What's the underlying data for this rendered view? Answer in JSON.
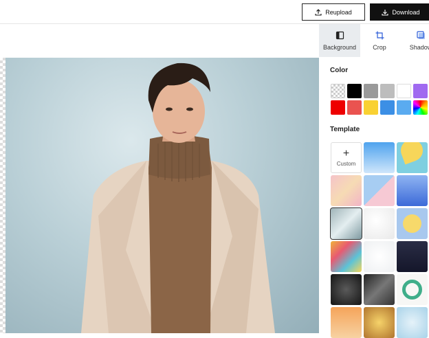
{
  "header": {
    "reupload_label": "Reupload",
    "download_label": "Download"
  },
  "panel": {
    "tabs": [
      {
        "label": "Background",
        "icon": "background-icon",
        "active": true
      },
      {
        "label": "Crop",
        "icon": "crop-icon",
        "active": false
      },
      {
        "label": "Shadow",
        "icon": "shadow-icon",
        "active": false
      }
    ],
    "color_title": "Color",
    "colors": [
      "transparent",
      "#000000",
      "#9a9a9a",
      "#bdbdbd",
      "#ffffff",
      "#a06af0",
      "#ee0000",
      "#ea5350",
      "#f9d132",
      "#3c8fe5",
      "#5aabf0",
      "rainbow"
    ],
    "template_title": "Template",
    "custom_label": "Custom"
  },
  "colors": {
    "accent": "#111111",
    "tab_active_bg": "#e9ecef"
  }
}
